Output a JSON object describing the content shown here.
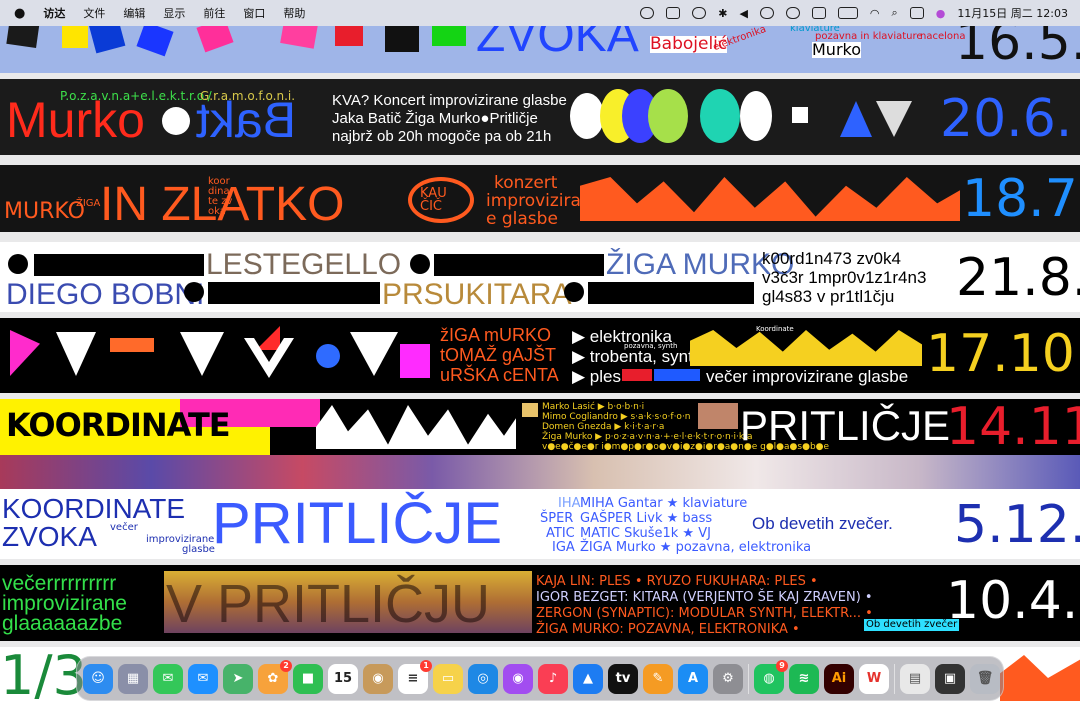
{
  "menubar": {
    "apple": "",
    "items": [
      "访达",
      "文件",
      "编辑",
      "显示",
      "前往",
      "窗口",
      "帮助"
    ],
    "datetime": "11月15日 周二  12:03"
  },
  "posters": {
    "p1": {
      "a": "ZVOKA",
      "b": "Babojelić",
      "c": "elektronika",
      "d": "klaviature",
      "e": "pozavna in klaviature",
      "f": "nacelona",
      "g": "Murko",
      "date": "16.5."
    },
    "p2": {
      "a": "P.o.z.a.v.n.a+e.l.e.k.t.r.o./",
      "b": "G.r.a.m.o.f.o.n.i.",
      "c": "Murko",
      "d": "Bakt",
      "e": "KVA? Koncert improvizirane glasbe",
      "f": "Jaka Batič Žiga Murko●Pritličje",
      "g": "najbrž  ob 20h mogoče pa ob 21h",
      "date": "20.6."
    },
    "p3": {
      "a": "MURKO",
      "b": "ŽIGA",
      "c": "IN ZLATKO",
      "d": "koor dina te zv oka",
      "e": "KAU ČIČ",
      "f": "konzert",
      "g": "improviziran",
      "h": "e glasbe",
      "date": "18.7."
    },
    "p4": {
      "a": "LESTEGELLO",
      "b": "ŽIGA MURKO",
      "c": "DIEGO BOBNI",
      "d": "PRSUKITARA",
      "e": "k00rd1n473 zv0k4",
      "f": "v3č3r 1mpr0v1z1r4n3",
      "g": "gl4s83 v pr1tl1čju",
      "date": "21.8."
    },
    "p5": {
      "a": "žIGA mURKO",
      "b": "tOMAŽ gAJŠT",
      "c": "uRŠKA cENTA",
      "d": "▶ elektronika",
      "e": "pozavna, synth",
      "f": "▶ trobenta, synth",
      "g": "▶ ples",
      "h": "večer improvizirane glasbe",
      "i": "Koordinate",
      "date": "17.10."
    },
    "p6": {
      "a": "KOORDINATE",
      "b": "Marko Lasić ▶ b·o·b·n·i",
      "c": "Mimo Cogliandro ▶ s·a·k·s·o·f·o·n",
      "d": "Domen Gnezda ▶ k·i·t·a·r·a",
      "e": "Žiga Murko ▶ p·o·z·a·v·n·a·+·e·l·e·k·t·r·o·n·i·k·a",
      "f": "v●e●č●e●r i●m●p●r●o●v●i●z●i●r●a●n●e g●l●a●s●b●e",
      "g": "PRITLIČJE",
      "date": "14.11."
    },
    "p7": {
      "a": "KOORDINATE",
      "b": "ZVOKA",
      "c": "večer",
      "d": "improvizirane",
      "e": "glasbe",
      "f": "PRITLIČJE",
      "g": "IHA",
      "h": "ŠPER",
      "i": "ATIC",
      "j": "IGA",
      "k": "MIHA Gantar ★ klaviature",
      "l": "GAŠPER Livk ★ bass",
      "m": "MATIC Skuše1k ★ VJ",
      "n": "ŽIGA Murko ★ pozavna, elektronika",
      "o": "Ob devetih zvečer.",
      "date": "5.12."
    },
    "p8": {
      "a": "večerrrrrrrrrr",
      "b": "improvizirane",
      "c": "glaaaaaazbe",
      "d": "V PRITLIČJU",
      "e": "KAJA LIN: PLES • RYUZO FUKUHARA: PLES •",
      "f": "IGOR BEZGET: KITARA (VERJENTO ŠE KAJ ZRAVEN) •",
      "g": "ZERGON (SYNAPTIC): MODULAR SYNTH, ELEKTR... •",
      "h": "ŽIGA MURKO: POZAVNA, ELEKTRONIKA •",
      "i": "Ob devetih zvečer",
      "date": "10.4."
    },
    "p9": {
      "a": "1/3"
    }
  },
  "dock": {
    "apps": [
      {
        "name": "Finder",
        "color": "#2d8cf0",
        "glyph": "☺"
      },
      {
        "name": "Launchpad",
        "color": "#8a8fa8",
        "glyph": "▦"
      },
      {
        "name": "Messages",
        "color": "#34c759",
        "glyph": "✉"
      },
      {
        "name": "Mail",
        "color": "#1e90ff",
        "glyph": "✉"
      },
      {
        "name": "Maps",
        "color": "#47b36a",
        "glyph": "➤"
      },
      {
        "name": "Photos",
        "color": "#f7a23b",
        "glyph": "✿",
        "badge": "2"
      },
      {
        "name": "FaceTime",
        "color": "#2fbf52",
        "glyph": "■"
      },
      {
        "name": "Calendar",
        "color": "#ffffff",
        "glyph": "15",
        "text": "#222"
      },
      {
        "name": "Contacts",
        "color": "#c79a5b",
        "glyph": "◉"
      },
      {
        "name": "Reminders",
        "color": "#ffffff",
        "glyph": "≡",
        "text": "#333",
        "badge": "1"
      },
      {
        "name": "Notes",
        "color": "#f6d24a",
        "glyph": "▭"
      },
      {
        "name": "Safari",
        "color": "#1e88e5",
        "glyph": "◎"
      },
      {
        "name": "Podcasts",
        "color": "#a24df0",
        "glyph": "◉"
      },
      {
        "name": "Music",
        "color": "#fa3e54",
        "glyph": "♪"
      },
      {
        "name": "Keynote",
        "color": "#1d7cf2",
        "glyph": "▲"
      },
      {
        "name": "TV",
        "color": "#111111",
        "glyph": "tv"
      },
      {
        "name": "Pages",
        "color": "#f59b23",
        "glyph": "✎"
      },
      {
        "name": "App Store",
        "color": "#1b8df5",
        "glyph": "A"
      },
      {
        "name": "System Settings",
        "color": "#8e8e93",
        "glyph": "⚙"
      },
      {
        "name": "WeChat",
        "color": "#20c35f",
        "glyph": "◍",
        "badge": "9"
      },
      {
        "name": "Spotify",
        "color": "#1db954",
        "glyph": "≋"
      },
      {
        "name": "Illustrator",
        "color": "#330000",
        "glyph": "Ai",
        "text": "#ff9a00"
      },
      {
        "name": "WPS",
        "color": "#ffffff",
        "glyph": "W",
        "text": "#e5322d"
      },
      {
        "name": "Preview",
        "color": "#e8e8e8",
        "glyph": "▤",
        "text": "#555"
      },
      {
        "name": "Recent",
        "color": "#333333",
        "glyph": "▣"
      },
      {
        "name": "Trash",
        "color": "#b8bcc4",
        "glyph": "🗑",
        "text": "#555"
      }
    ]
  }
}
